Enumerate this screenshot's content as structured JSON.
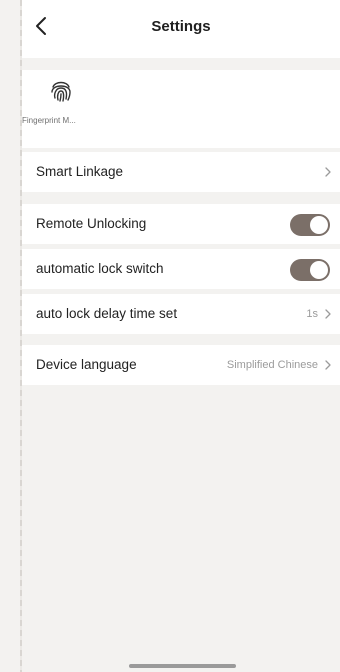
{
  "header": {
    "title": "Settings",
    "back_icon": "chevron-left-icon"
  },
  "fingerprint": {
    "icon": "fingerprint-icon",
    "label": "Fingerprint M..."
  },
  "rows": {
    "smart_linkage": {
      "label": "Smart Linkage"
    },
    "remote_unlocking": {
      "label": "Remote Unlocking",
      "enabled": true
    },
    "auto_lock_switch": {
      "label": "automatic lock switch",
      "enabled": true
    },
    "auto_lock_delay": {
      "label": "auto lock delay time set",
      "value": "1s"
    },
    "device_language": {
      "label": "Device language",
      "value": "Simplified Chinese"
    }
  },
  "colors": {
    "toggle_on": "#7b6f68",
    "background": "#f3f2f0",
    "card": "#ffffff",
    "secondary_text": "#9b9b9b"
  }
}
